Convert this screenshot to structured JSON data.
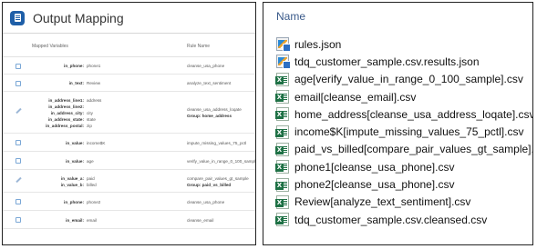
{
  "left_panel": {
    "title": "Output Mapping",
    "columns": {
      "mapped": "Mapped Variables",
      "rule": "Rule Name"
    },
    "rows": [
      {
        "icon": "document-icon",
        "labels": [
          "in_phone:"
        ],
        "values": [
          "phone1"
        ],
        "rule": [
          "cleanse_usa_phone"
        ],
        "group": ""
      },
      {
        "icon": "document-icon",
        "labels": [
          "in_text:"
        ],
        "values": [
          "Review"
        ],
        "rule": [
          "analyze_text_sentiment"
        ],
        "group": ""
      },
      {
        "icon": "pencil-icon",
        "labels": [
          "in_address_line1:",
          "in_address_line2:",
          "in_address_city:",
          "in_address_state:",
          "in_address_postal:"
        ],
        "values": [
          "address",
          "",
          "city",
          "state",
          "zip"
        ],
        "rule": [
          "cleanse_usa_address_loqate"
        ],
        "group": "Group: home_address"
      },
      {
        "icon": "document-icon",
        "labels": [
          "in_value:"
        ],
        "values": [
          "income$K"
        ],
        "rule": [
          "impute_missing_values_75_pctl"
        ],
        "group": ""
      },
      {
        "icon": "document-icon",
        "labels": [
          "in_value:"
        ],
        "values": [
          "age"
        ],
        "rule": [
          "verify_value_in_range_0_100_sample"
        ],
        "group": ""
      },
      {
        "icon": "pencil-icon",
        "labels": [
          "in_value_a:",
          "in_value_b:"
        ],
        "values": [
          "paid",
          "billed"
        ],
        "rule": [
          "compare_pair_values_gt_sample"
        ],
        "group": "Group: paid_vs_billed"
      },
      {
        "icon": "document-icon",
        "labels": [
          "in_phone:"
        ],
        "values": [
          "phone2"
        ],
        "rule": [
          "cleanse_usa_phone"
        ],
        "group": ""
      },
      {
        "icon": "document-icon",
        "labels": [
          "in_email:"
        ],
        "values": [
          "email"
        ],
        "rule": [
          "cleanse_email"
        ],
        "group": ""
      }
    ]
  },
  "right_panel": {
    "column_header": "Name",
    "files": [
      {
        "name": "rules.json",
        "type": "json"
      },
      {
        "name": "tdq_customer_sample.csv.results.json",
        "type": "json"
      },
      {
        "name": "age[verify_value_in_range_0_100_sample].csv",
        "type": "csv"
      },
      {
        "name": "email[cleanse_email].csv",
        "type": "csv"
      },
      {
        "name": "home_address[cleanse_usa_address_loqate].csv",
        "type": "csv"
      },
      {
        "name": "income$K[impute_missing_values_75_pctl].csv",
        "type": "csv"
      },
      {
        "name": "paid_vs_billed[compare_pair_values_gt_sample].csv",
        "type": "csv"
      },
      {
        "name": "phone1[cleanse_usa_phone].csv",
        "type": "csv"
      },
      {
        "name": "phone2[cleanse_usa_phone].csv",
        "type": "csv"
      },
      {
        "name": "Review[analyze_text_sentiment].csv",
        "type": "csv"
      },
      {
        "name": "tdq_customer_sample.csv.cleansed.csv",
        "type": "csv"
      }
    ]
  }
}
